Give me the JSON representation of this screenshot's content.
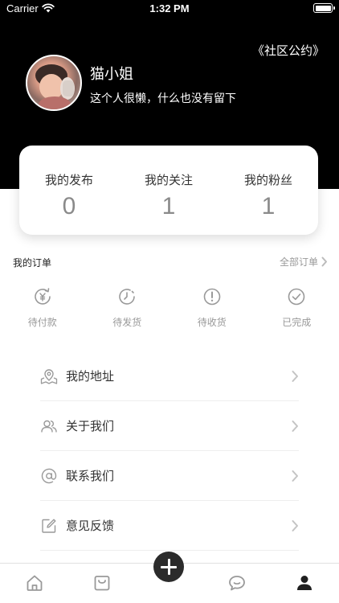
{
  "status_bar": {
    "carrier": "Carrier",
    "time": "1:32 PM"
  },
  "header": {
    "community_link": "《社区公约》"
  },
  "profile": {
    "name": "猫小姐",
    "bio": "这个人很懒，什么也没有留下"
  },
  "stats": [
    {
      "label": "我的发布",
      "value": "0"
    },
    {
      "label": "我的关注",
      "value": "1"
    },
    {
      "label": "我的粉丝",
      "value": "1"
    }
  ],
  "orders": {
    "title": "我的订单",
    "all_label": "全部订单",
    "items": [
      {
        "label": "待付款",
        "icon": "yen-refresh-icon"
      },
      {
        "label": "待发货",
        "icon": "clock-icon"
      },
      {
        "label": "待收货",
        "icon": "exclamation-circle-icon"
      },
      {
        "label": "已完成",
        "icon": "check-circle-icon"
      }
    ]
  },
  "menu": [
    {
      "label": "我的地址",
      "icon": "map-pin-icon"
    },
    {
      "label": "关于我们",
      "icon": "users-icon"
    },
    {
      "label": "联系我们",
      "icon": "at-icon"
    },
    {
      "label": "意见反馈",
      "icon": "edit-icon"
    }
  ],
  "tab_bar": {
    "items": [
      "home-icon",
      "shopping-bag-icon",
      "add-icon",
      "chat-bubble-icon",
      "person-icon"
    ],
    "active": "person-icon"
  },
  "colors": {
    "header_bg": "#000000",
    "muted_text": "#999999",
    "value_text": "#8a8a8a",
    "add_button": "#2b2b2b"
  }
}
